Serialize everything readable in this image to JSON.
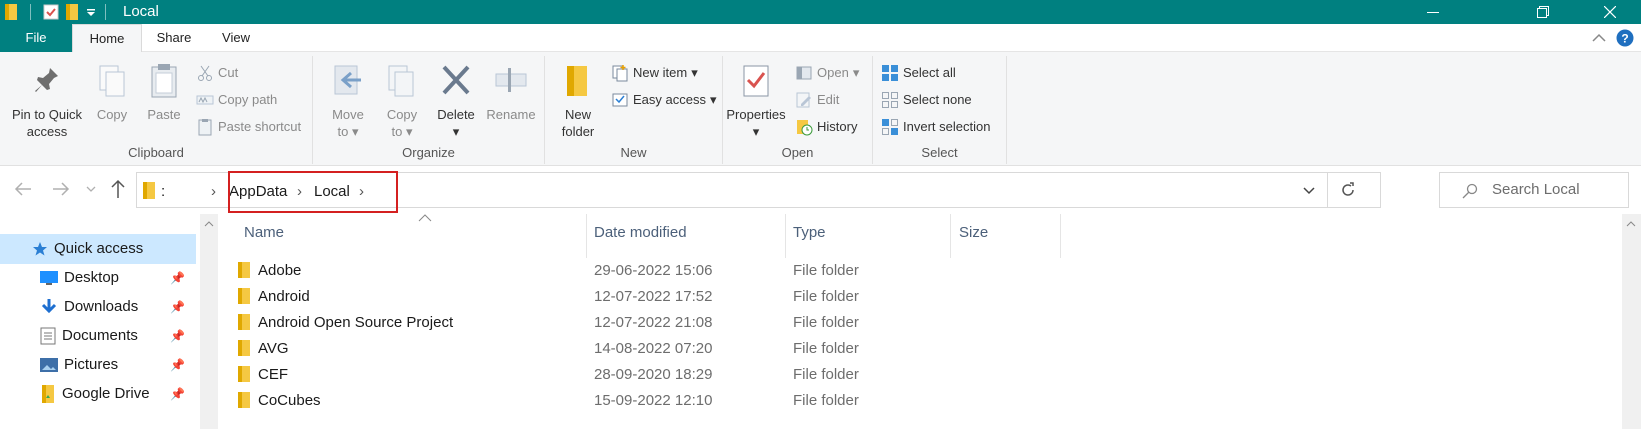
{
  "window": {
    "title": "Local"
  },
  "tabs": {
    "file": "File",
    "home": "Home",
    "share": "Share",
    "view": "View"
  },
  "ribbon": {
    "clipboard": {
      "label": "Clipboard",
      "pin_line1": "Pin to Quick",
      "pin_line2": "access",
      "copy": "Copy",
      "paste": "Paste",
      "cut": "Cut",
      "copy_path": "Copy path",
      "paste_shortcut": "Paste shortcut"
    },
    "organize": {
      "label": "Organize",
      "move_line1": "Move",
      "move_line2": "to",
      "copy_line1": "Copy",
      "copy_line2": "to",
      "delete": "Delete",
      "rename": "Rename"
    },
    "new": {
      "label": "New",
      "folder_line1": "New",
      "folder_line2": "folder",
      "new_item": "New item",
      "easy_access": "Easy access"
    },
    "open": {
      "label": "Open",
      "properties": "Properties",
      "open": "Open",
      "edit": "Edit",
      "history": "History"
    },
    "select": {
      "label": "Select",
      "select_all": "Select all",
      "select_none": "Select none",
      "invert": "Invert selection"
    }
  },
  "address": {
    "root_sep": ":",
    "crumbs": [
      "AppData",
      "Local"
    ],
    "search_placeholder": "Search Local"
  },
  "nav_pane": {
    "items": [
      "Quick access",
      "Desktop",
      "Downloads",
      "Documents",
      "Pictures",
      "Google Drive"
    ]
  },
  "columns": {
    "name": "Name",
    "date": "Date modified",
    "type": "Type",
    "size": "Size"
  },
  "files": [
    {
      "name": "Adobe",
      "date": "29-06-2022 15:06",
      "type": "File folder"
    },
    {
      "name": "Android",
      "date": "12-07-2022 17:52",
      "type": "File folder"
    },
    {
      "name": "Android Open Source Project",
      "date": "12-07-2022 21:08",
      "type": "File folder"
    },
    {
      "name": "AVG",
      "date": "14-08-2022 07:20",
      "type": "File folder"
    },
    {
      "name": "CEF",
      "date": "28-09-2020 18:29",
      "type": "File folder"
    },
    {
      "name": "CoCubes",
      "date": "15-09-2022 12:10",
      "type": "File folder"
    }
  ],
  "colors": {
    "titlebar": "#008080",
    "highlight": "#d42020",
    "selected": "#cce8ff"
  }
}
